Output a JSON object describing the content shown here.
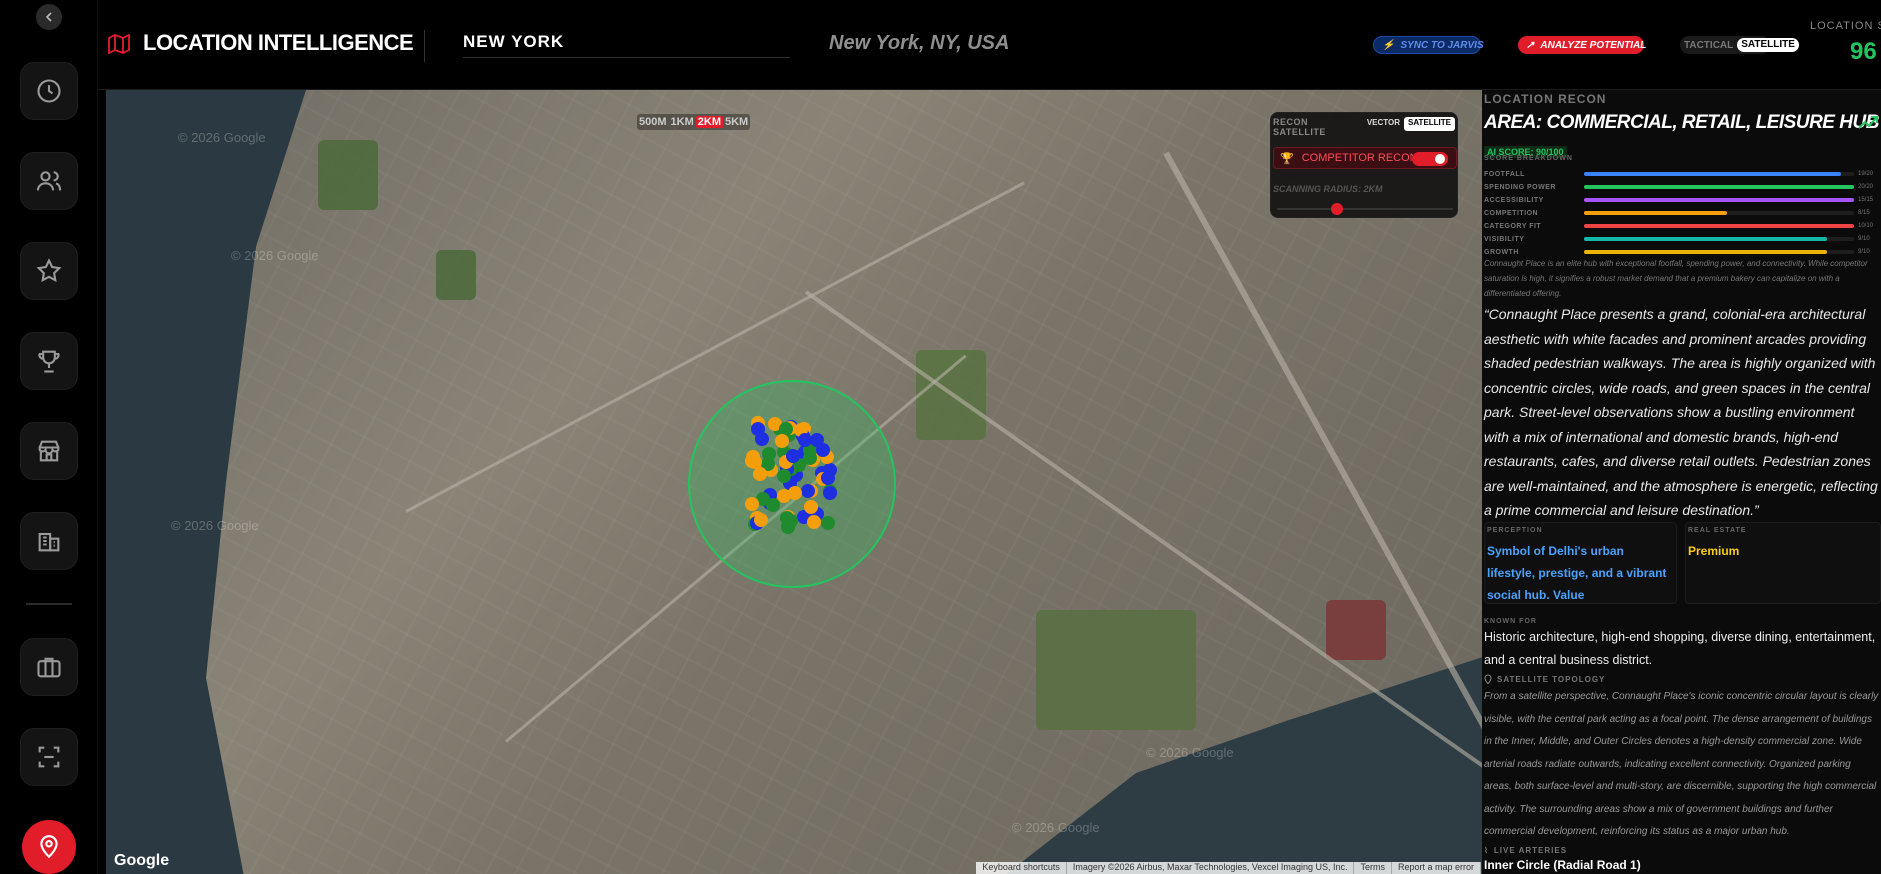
{
  "header": {
    "brand_title": "LOCATION INTELLIGENCE",
    "city_input_value": "NEW YORK",
    "location_label": "New York, NY, USA",
    "sync_label": "SYNC TO JARVIS",
    "analyze_label": "ANALYZE POTENTIAL",
    "view_options": [
      "TACTICAL",
      "SATELLITE"
    ],
    "view_selected": "SATELLITE",
    "score_label": "LOCATION SC",
    "score_value": "96"
  },
  "sidebar": {
    "items": [
      {
        "name": "history",
        "icon": "clock-icon"
      },
      {
        "name": "users",
        "icon": "users-icon"
      },
      {
        "name": "favorites",
        "icon": "star-icon"
      },
      {
        "name": "trophy",
        "icon": "trophy-icon"
      },
      {
        "name": "store",
        "icon": "store-icon"
      },
      {
        "name": "buildings",
        "icon": "building-icon"
      },
      {
        "name": "briefcase",
        "icon": "briefcase-icon"
      },
      {
        "name": "scan",
        "icon": "scan-icon"
      }
    ],
    "locate_icon": "map-pin-icon"
  },
  "map": {
    "radius_options": [
      "500M",
      "1KM",
      "2KM",
      "5KM"
    ],
    "radius_selected": "2KM",
    "watermark": "© 2026 Google",
    "google_logo": "Google",
    "attribution": [
      "Keyboard shortcuts",
      "Imagery ©2026 Airbus, Maxar Technologies, Vexcel Imaging US, Inc.",
      "Terms",
      "Report a map error"
    ]
  },
  "recon_overlay": {
    "title": "RECON SATELLITE",
    "modes": [
      "VECTOR",
      "SATELLITE"
    ],
    "mode_selected": "SATELLITE",
    "competitor_label": "COMPETITOR RECON",
    "competitor_on": true,
    "scan_label": "SCANNING RADIUS: 2KM"
  },
  "panel": {
    "kicker": "LOCATION RECON",
    "area_title": "AREA: COMMERCIAL, RETAIL, LEISURE HUB",
    "ai_score": "AI SCORE: 90/100",
    "breakdown_label": "SCORE BREAKDOWN",
    "breakdown": [
      {
        "label": "FOOTFALL",
        "value": "19/20",
        "fraction": 0.95,
        "color": "#3b82f6"
      },
      {
        "label": "SPENDING POWER",
        "value": "20/20",
        "fraction": 1.0,
        "color": "#22c55e"
      },
      {
        "label": "ACCESSIBILITY",
        "value": "15/15",
        "fraction": 1.0,
        "color": "#a855f7"
      },
      {
        "label": "COMPETITION",
        "value": "8/15",
        "fraction": 0.53,
        "color": "#f59e0b"
      },
      {
        "label": "CATEGORY FIT",
        "value": "10/10",
        "fraction": 1.0,
        "color": "#ef4444"
      },
      {
        "label": "VISIBILITY",
        "value": "9/10",
        "fraction": 0.9,
        "color": "#14b8a6"
      },
      {
        "label": "GROWTH",
        "value": "9/10",
        "fraction": 0.9,
        "color": "#eab308"
      }
    ],
    "summary": "Connaught Place is an elite hub with exceptional footfall, spending power, and connectivity. While competitor saturation is high, it signifies a robust market demand that a premium bakery can capitalize on with a differentiated offering.",
    "quote": "“Connaught Place presents a grand, colonial-era architectural aesthetic with white facades and prominent arcades providing shaded pedestrian walkways. The area is highly organized with concentric circles, wide roads, and green spaces in the central park. Street-level observations show a bustling environment with a mix of international and domestic brands, high-end restaurants, cafes, and diverse retail outlets. Pedestrian zones are well-maintained, and the atmosphere is energetic, reflecting a prime commercial and leisure destination.”",
    "perception_label": "PERCEPTION",
    "perception_value": "Symbol of Delhi's urban lifestyle, prestige, and a vibrant social hub. Value",
    "real_estate_label": "REAL ESTATE",
    "real_estate_value": "Premium",
    "known_for_label": "KNOWN FOR",
    "known_for": "Historic architecture, high-end shopping, diverse dining, entertainment, and a central business district.",
    "topology_label": "SATELLITE TOPOLOGY",
    "topology": "From a satellite perspective, Connaught Place's iconic concentric circular layout is clearly visible, with the central park acting as a focal point. The dense arrangement of buildings in the Inner, Middle, and Outer Circles denotes a high-density commercial zone. Wide arterial roads radiate outwards, indicating excellent connectivity. Organized parking areas, both surface-level and multi-story, are discernible, supporting the high commercial activity. The surrounding areas show a mix of government buildings and further commercial development, reinforcing its status as a major urban hub.",
    "arteries_label": "LIVE ARTERIES",
    "artery_1": "Inner Circle (Radial Road 1)"
  },
  "colors": {
    "accent_red": "#e11d2a",
    "score_green": "#22c55e",
    "perception_blue": "#4aa3ff",
    "real_estate_yellow": "#facc15"
  }
}
